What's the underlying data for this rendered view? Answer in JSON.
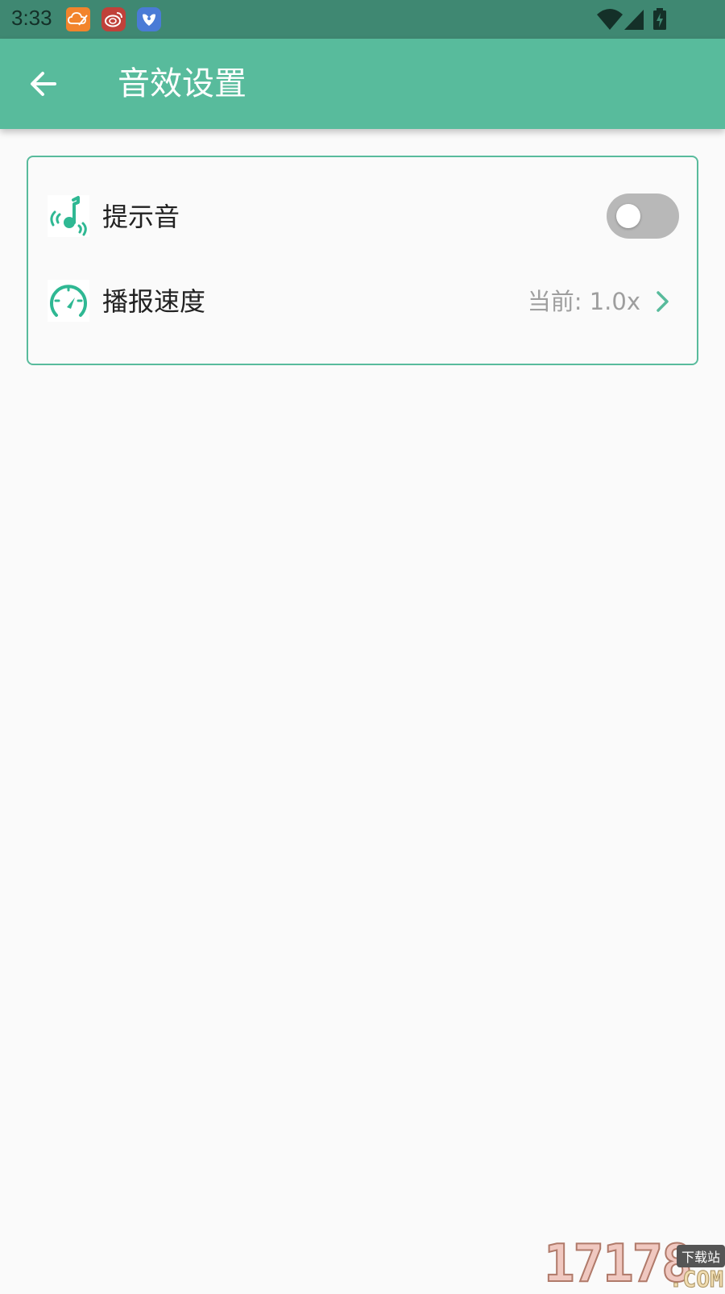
{
  "status_bar": {
    "time": "3:33",
    "notification_icons": [
      "cloud-sign-icon",
      "weibo-icon",
      "bird-app-icon"
    ],
    "system_icons": [
      "wifi-icon",
      "signal-icon",
      "battery-charging-icon"
    ]
  },
  "app_bar": {
    "title": "音效设置",
    "back_icon": "arrow-left-icon",
    "background_color": "#58bb9c"
  },
  "settings": {
    "items": [
      {
        "label": "提示音",
        "icon": "music-note-sound-icon",
        "control": "toggle",
        "toggle_on": false
      },
      {
        "label": "播报速度",
        "icon": "speedometer-icon",
        "value": "当前: 1.0x",
        "control": "chevron"
      }
    ]
  },
  "colors": {
    "accent": "#58bb9c",
    "icon_teal": "#2fb893",
    "status_bar": "#3f8872",
    "background": "#fafafa"
  },
  "watermark": {
    "number": "17178",
    "tag": "下载站",
    "domain": ".COM"
  }
}
